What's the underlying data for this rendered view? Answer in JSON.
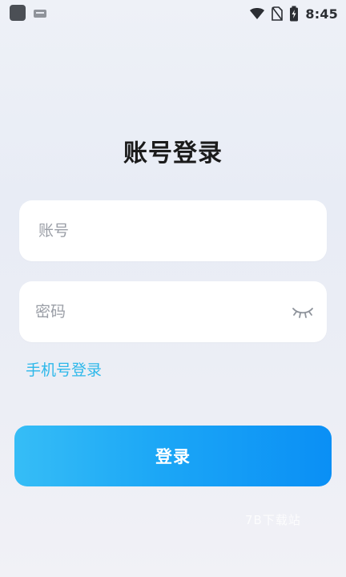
{
  "status_bar": {
    "time": "8:45"
  },
  "page": {
    "title": "账号登录"
  },
  "form": {
    "account_placeholder": "账号",
    "account_value": "",
    "password_placeholder": "密码",
    "password_value": ""
  },
  "links": {
    "phone_login": "手机号登录"
  },
  "buttons": {
    "login": "登录"
  },
  "watermark": {
    "text": "7B下载站"
  },
  "colors": {
    "link": "#2db8ea",
    "button_start": "#36bdf6",
    "button_end": "#0a8ff5",
    "title": "#1b1b1b"
  },
  "icons": {
    "app": "app-icon",
    "keyboard": "keyboard-icon",
    "wifi": "wifi-icon",
    "no_sim": "no-sim-icon",
    "battery": "battery-icon",
    "password_visibility": "eye-closed-icon"
  }
}
